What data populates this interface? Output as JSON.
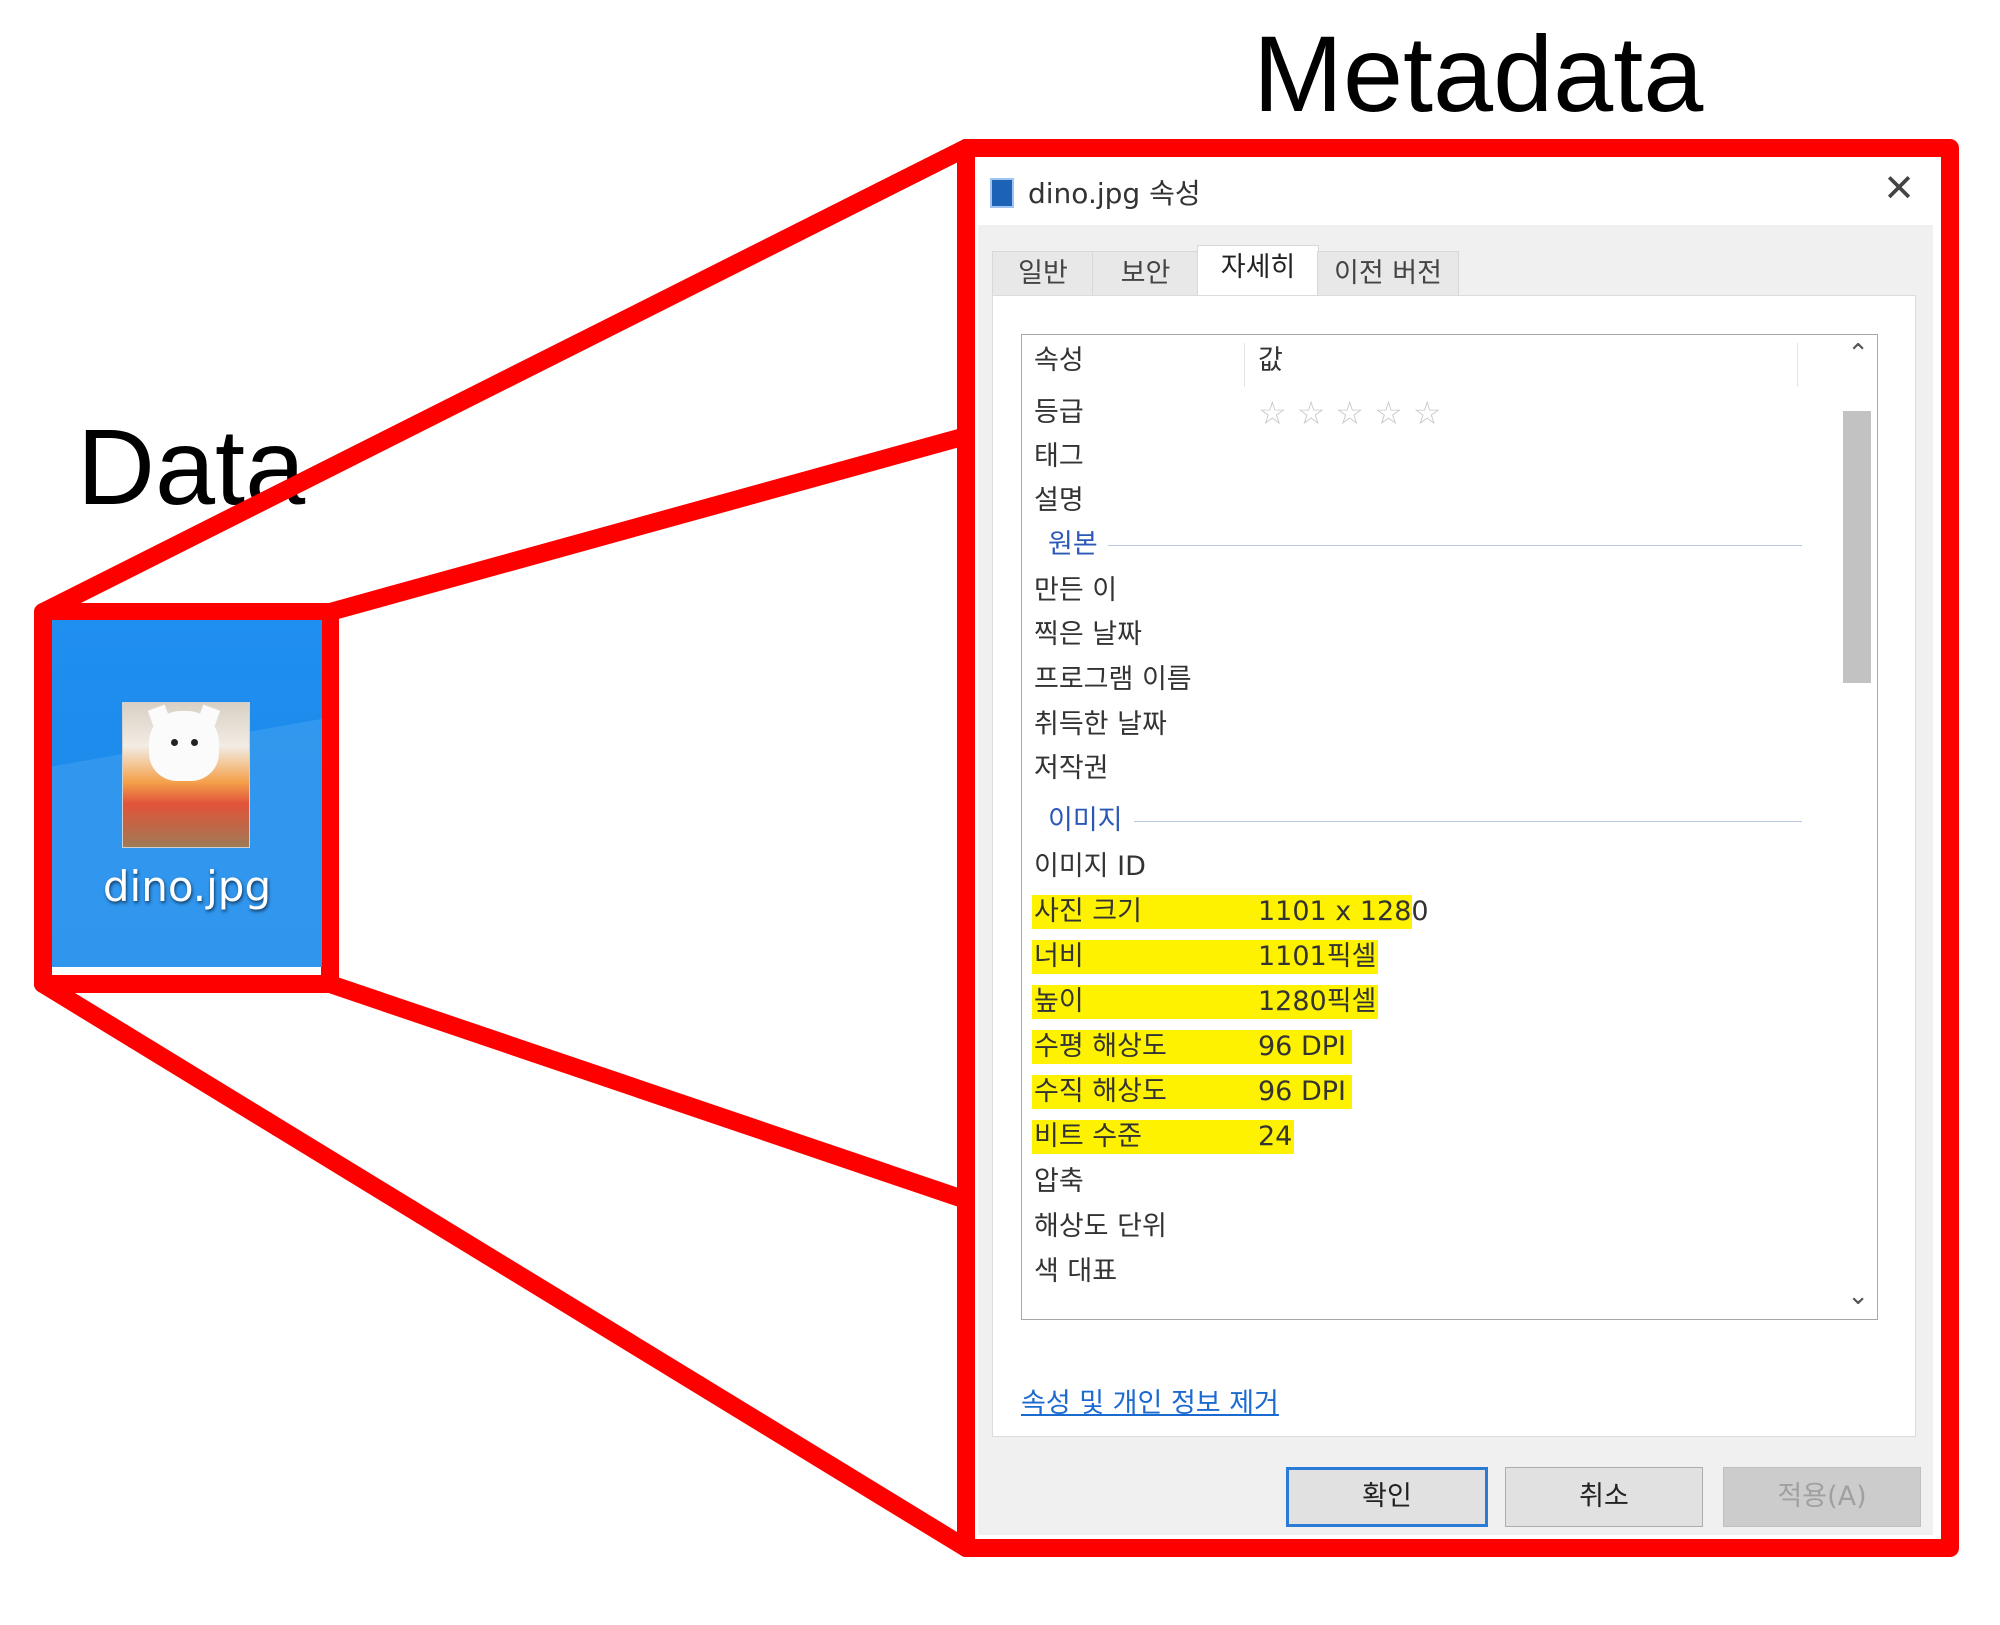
{
  "headings": {
    "data": "Data",
    "metadata": "Metadata"
  },
  "colors": {
    "highlight_frame": "#ff0000",
    "desktop_blue": "#1a86e6",
    "highlight_marker": "#fff200",
    "link_blue": "#1a6ad0"
  },
  "desktop_icon": {
    "file_name": "dino.jpg"
  },
  "dialog": {
    "title": "dino.jpg 속성",
    "close_icon": "close-icon",
    "tabs": [
      {
        "label": "일반",
        "active": false
      },
      {
        "label": "보안",
        "active": false
      },
      {
        "label": "자세히",
        "active": true
      },
      {
        "label": "이전 버전",
        "active": false
      }
    ],
    "columns": {
      "property": "속성",
      "value": "값"
    },
    "rating": {
      "label": "등급",
      "stars_filled": 0,
      "stars_total": 5
    },
    "rows_top": [
      {
        "key": "태그",
        "value": ""
      },
      {
        "key": "설명",
        "value": ""
      }
    ],
    "group_origin": {
      "label": "원본",
      "rows": [
        {
          "key": "만든 이",
          "value": ""
        },
        {
          "key": "찍은 날짜",
          "value": ""
        },
        {
          "key": "프로그램 이름",
          "value": ""
        },
        {
          "key": "취득한 날짜",
          "value": ""
        },
        {
          "key": "저작권",
          "value": ""
        }
      ]
    },
    "group_image": {
      "label": "이미지",
      "rows": [
        {
          "key": "이미지 ID",
          "value": "",
          "highlighted": false
        },
        {
          "key": "사진 크기",
          "value": "1101 x 1280",
          "highlighted": true
        },
        {
          "key": "너비",
          "value": "1101픽셀",
          "highlighted": true
        },
        {
          "key": "높이",
          "value": "1280픽셀",
          "highlighted": true
        },
        {
          "key": "수평 해상도",
          "value": "96 DPI",
          "highlighted": true
        },
        {
          "key": "수직 해상도",
          "value": "96 DPI",
          "highlighted": true
        },
        {
          "key": "비트 수준",
          "value": "24",
          "highlighted": true
        },
        {
          "key": "압축",
          "value": "",
          "highlighted": false
        },
        {
          "key": "해상도 단위",
          "value": "",
          "highlighted": false
        },
        {
          "key": "색 대표",
          "value": "",
          "highlighted": false
        }
      ]
    },
    "remove_link": "속성 및 개인 정보 제거",
    "buttons": {
      "ok": "확인",
      "cancel": "취소",
      "apply": "적용(A)"
    }
  }
}
